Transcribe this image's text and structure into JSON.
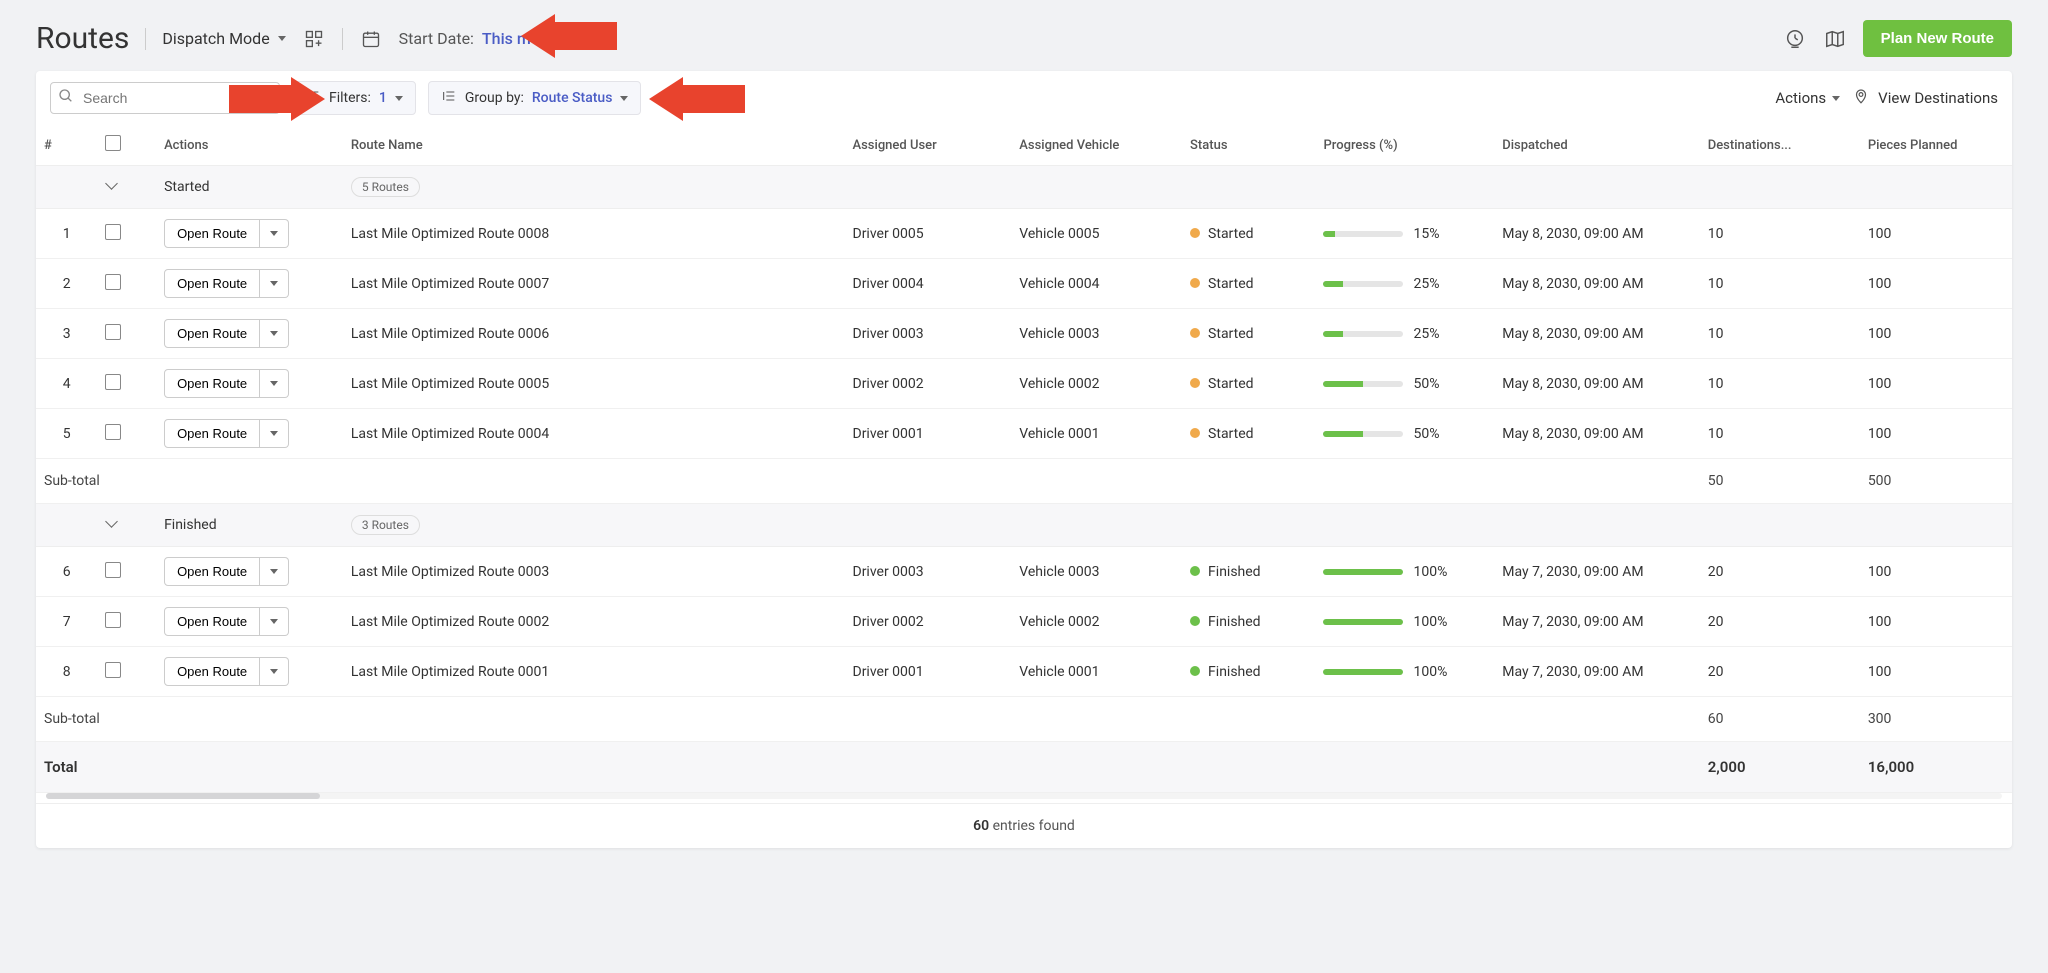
{
  "header": {
    "title": "Routes",
    "dispatch_mode_label": "Dispatch Mode",
    "start_date_label": "Start Date:",
    "start_date_value": "This month",
    "plan_btn": "Plan New Route"
  },
  "toolbar": {
    "search_placeholder": "Search",
    "filters_label": "Filters:",
    "filters_count": "1",
    "group_by_label": "Group by:",
    "group_by_value": "Route Status",
    "actions_label": "Actions",
    "view_destinations_label": "View Destinations"
  },
  "columns": {
    "num": "#",
    "actions": "Actions",
    "route_name": "Route Name",
    "assigned_user": "Assigned User",
    "assigned_vehicle": "Assigned Vehicle",
    "status": "Status",
    "progress": "Progress (%)",
    "dispatched": "Dispatched",
    "destinations": "Destinations...",
    "pieces": "Pieces Planned"
  },
  "open_route_label": "Open Route",
  "groups": [
    {
      "name": "Started",
      "count_label": "5 Routes",
      "rows": [
        {
          "n": "1",
          "route": "Last Mile Optimized Route 0008",
          "user": "Driver 0005",
          "vehicle": "Vehicle 0005",
          "status": "Started",
          "dot": "started",
          "progress": 15,
          "dispatched": "May 8, 2030, 09:00 AM",
          "dest": "10",
          "pieces": "100"
        },
        {
          "n": "2",
          "route": "Last Mile Optimized Route 0007",
          "user": "Driver 0004",
          "vehicle": "Vehicle 0004",
          "status": "Started",
          "dot": "started",
          "progress": 25,
          "dispatched": "May 8, 2030, 09:00 AM",
          "dest": "10",
          "pieces": "100"
        },
        {
          "n": "3",
          "route": "Last Mile Optimized Route 0006",
          "user": "Driver 0003",
          "vehicle": "Vehicle 0003",
          "status": "Started",
          "dot": "started",
          "progress": 25,
          "dispatched": "May 8, 2030, 09:00 AM",
          "dest": "10",
          "pieces": "100"
        },
        {
          "n": "4",
          "route": "Last Mile Optimized Route 0005",
          "user": "Driver 0002",
          "vehicle": "Vehicle 0002",
          "status": "Started",
          "dot": "started",
          "progress": 50,
          "dispatched": "May 8, 2030, 09:00 AM",
          "dest": "10",
          "pieces": "100"
        },
        {
          "n": "5",
          "route": "Last Mile Optimized Route 0004",
          "user": "Driver 0001",
          "vehicle": "Vehicle 0001",
          "status": "Started",
          "dot": "started",
          "progress": 50,
          "dispatched": "May 8, 2030, 09:00 AM",
          "dest": "10",
          "pieces": "100"
        }
      ],
      "subtotal": {
        "label": "Sub-total",
        "dest": "50",
        "pieces": "500"
      }
    },
    {
      "name": "Finished",
      "count_label": "3 Routes",
      "rows": [
        {
          "n": "6",
          "route": "Last Mile Optimized Route 0003",
          "user": "Driver 0003",
          "vehicle": "Vehicle 0003",
          "status": "Finished",
          "dot": "finished",
          "progress": 100,
          "dispatched": "May 7, 2030, 09:00 AM",
          "dest": "20",
          "pieces": "100"
        },
        {
          "n": "7",
          "route": "Last Mile Optimized Route 0002",
          "user": "Driver 0002",
          "vehicle": "Vehicle 0002",
          "status": "Finished",
          "dot": "finished",
          "progress": 100,
          "dispatched": "May 7, 2030, 09:00 AM",
          "dest": "20",
          "pieces": "100"
        },
        {
          "n": "8",
          "route": "Last Mile Optimized Route 0001",
          "user": "Driver 0001",
          "vehicle": "Vehicle 0001",
          "status": "Finished",
          "dot": "finished",
          "progress": 100,
          "dispatched": "May 7, 2030, 09:00 AM",
          "dest": "20",
          "pieces": "100"
        }
      ],
      "subtotal": {
        "label": "Sub-total",
        "dest": "60",
        "pieces": "300"
      }
    }
  ],
  "total": {
    "label": "Total",
    "dest": "2,000",
    "pieces": "16,000"
  },
  "footer": {
    "count": "60",
    "suffix": " entries found"
  }
}
